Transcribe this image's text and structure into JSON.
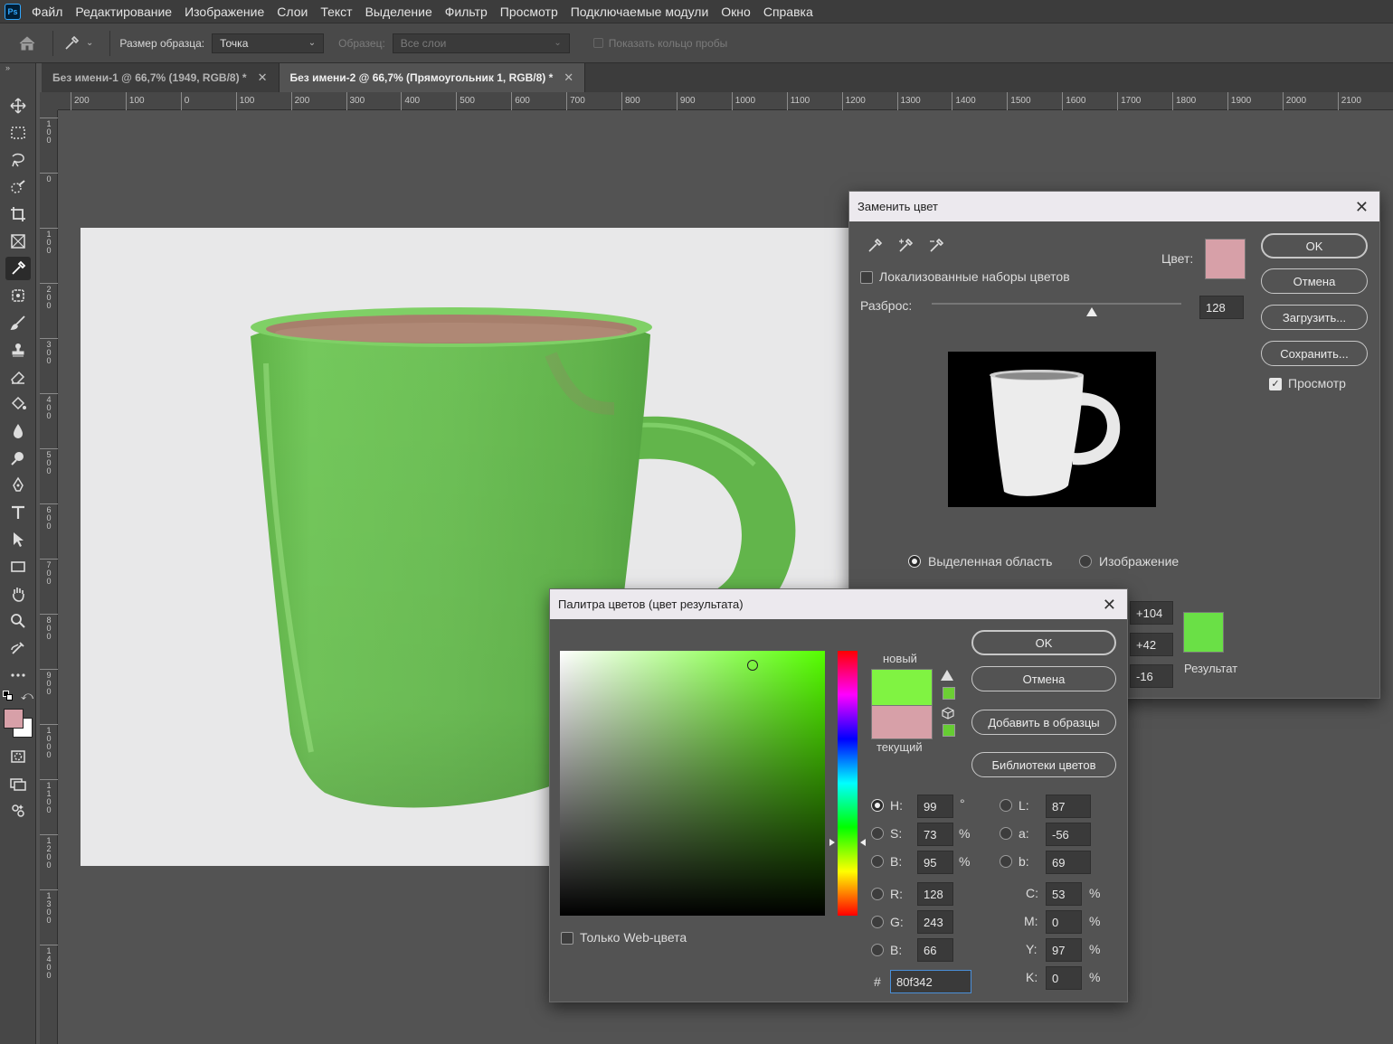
{
  "app": {
    "logo": "Ps"
  },
  "menu": [
    "Файл",
    "Редактирование",
    "Изображение",
    "Слои",
    "Текст",
    "Выделение",
    "Фильтр",
    "Просмотр",
    "Подключаемые модули",
    "Окно",
    "Справка"
  ],
  "options": {
    "sample_size_label": "Размер образца:",
    "sample_size_value": "Точка",
    "sample_label": "Образец:",
    "sample_value": "Все слои",
    "show_ring_label": "Показать кольцо пробы"
  },
  "tabs": [
    {
      "label": "Без имени-1 @ 66,7% (1949, RGB/8) *",
      "active": false
    },
    {
      "label": "Без имени-2 @ 66,7% (Прямоугольник 1, RGB/8) *",
      "active": true
    }
  ],
  "ruler_h": [
    "200",
    "100",
    "0",
    "100",
    "200",
    "300",
    "400",
    "500",
    "600",
    "700",
    "800",
    "900",
    "1000",
    "1100",
    "1200",
    "1300",
    "1400",
    "1500",
    "1600",
    "1700",
    "1800",
    "1900",
    "2000",
    "2100"
  ],
  "ruler_v": [
    "1\n0\n0",
    "0",
    "1\n0\n0",
    "2\n0\n0",
    "3\n0\n0",
    "4\n0\n0",
    "5\n0\n0",
    "6\n0\n0",
    "7\n0\n0",
    "8\n0\n0",
    "9\n0\n0",
    "1\n0\n0\n0",
    "1\n1\n0\n0",
    "1\n2\n0\n0",
    "1\n3\n0\n0",
    "1\n4\n0\n0"
  ],
  "replace": {
    "title": "Заменить цвет",
    "color_label": "Цвет:",
    "color_swatch": "#d7a0a8",
    "localized_label": "Локализованные наборы цветов",
    "localized_checked": false,
    "fuzziness_label": "Разброс:",
    "fuzziness_value": "128",
    "ok": "OK",
    "cancel": "Отмена",
    "load": "Загрузить...",
    "save": "Сохранить...",
    "preview_label": "Просмотр",
    "preview_checked": true,
    "selection_label": "Выделенная область",
    "image_label": "Изображение",
    "hue_value": "+104",
    "sat_value": "+42",
    "light_value": "-16",
    "result_label": "Результат",
    "result_swatch": "#6ae046"
  },
  "picker": {
    "title": "Палитра цветов (цвет результата)",
    "new_label": "новый",
    "current_label": "текущий",
    "new_color": "#80f342",
    "current_color": "#d7a0a8",
    "ok": "OK",
    "cancel": "Отмена",
    "add_swatches": "Добавить в образцы",
    "color_libraries": "Библиотеки цветов",
    "web_only_label": "Только Web-цвета",
    "hsb": [
      {
        "label": "H:",
        "value": "99",
        "unit": "°",
        "selected": true
      },
      {
        "label": "S:",
        "value": "73",
        "unit": "%",
        "selected": false
      },
      {
        "label": "B:",
        "value": "95",
        "unit": "%",
        "selected": false
      }
    ],
    "rgb": [
      {
        "label": "R:",
        "value": "128"
      },
      {
        "label": "G:",
        "value": "243"
      },
      {
        "label": "B:",
        "value": "66"
      }
    ],
    "lab": [
      {
        "label": "L:",
        "value": "87"
      },
      {
        "label": "a:",
        "value": "-56"
      },
      {
        "label": "b:",
        "value": "69"
      }
    ],
    "cmyk": [
      {
        "label": "C:",
        "value": "53",
        "unit": "%"
      },
      {
        "label": "M:",
        "value": "0",
        "unit": "%"
      },
      {
        "label": "Y:",
        "value": "97",
        "unit": "%"
      },
      {
        "label": "K:",
        "value": "0",
        "unit": "%"
      }
    ],
    "hex_symbol": "#",
    "hex_value": "80f342",
    "hue_degrees": 99,
    "saturation_pct": 73,
    "brightness_pct": 95
  },
  "colors": {
    "foreground": "#d7a0a8",
    "background": "#ffffff",
    "mug": "#6dbf55"
  }
}
